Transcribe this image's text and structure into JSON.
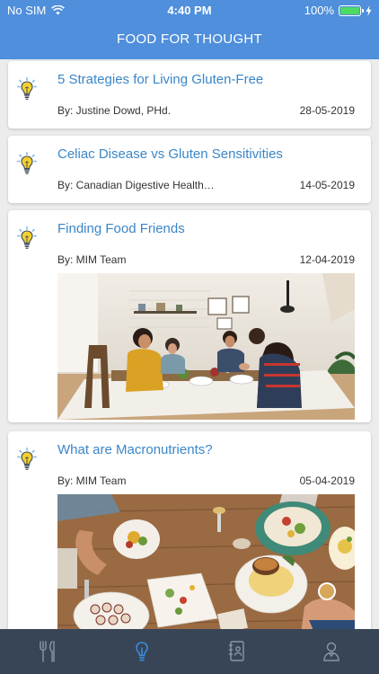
{
  "status_bar": {
    "carrier": "No SIM",
    "time": "4:40 PM",
    "battery": "100%"
  },
  "header": {
    "title": "FOOD FOR THOUGHT"
  },
  "articles": [
    {
      "title": "5 Strategies for Living Gluten-Free",
      "author": "By: Justine Dowd, PHd.",
      "date": "28-05-2019",
      "icon": "lightbulb-icon"
    },
    {
      "title": "Celiac Disease vs Gluten Sensitivities",
      "author": "By: Canadian Digestive Health…",
      "date": "14-05-2019",
      "icon": "lightbulb-icon"
    },
    {
      "title": "Finding Food Friends",
      "author": "By: MIM Team",
      "date": "12-04-2019",
      "icon": "lightbulb-icon",
      "image": "friends-dining-photo"
    },
    {
      "title": "What are Macronutrients?",
      "author": "By: MIM Team",
      "date": "05-04-2019",
      "icon": "lightbulb-icon",
      "image": "food-table-photo"
    }
  ],
  "tabbar": {
    "tabs": [
      {
        "icon": "fork-knife-icon",
        "active": false
      },
      {
        "icon": "lightbulb-icon",
        "active": true
      },
      {
        "icon": "notebook-icon",
        "active": false
      },
      {
        "icon": "profile-icon",
        "active": false
      }
    ]
  },
  "colors": {
    "header": "#4f8fdc",
    "link": "#3a86c8",
    "tabbar": "#384556",
    "tab_active": "#3a8fe0",
    "tab_inactive": "#8b97a6"
  }
}
